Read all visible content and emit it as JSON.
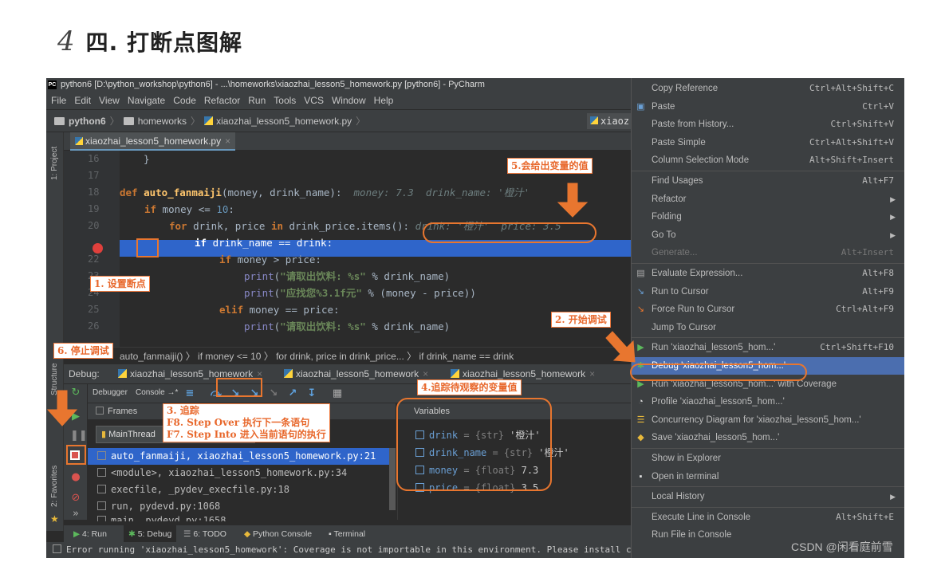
{
  "heading": {
    "number": "4",
    "title": "四. 打断点图解"
  },
  "window_title": "python6 [D:\\python_workshop\\python6] - ...\\homeworks\\xiaozhai_lesson5_homework.py [python6] - PyCharm",
  "menubar": [
    "File",
    "Edit",
    "View",
    "Navigate",
    "Code",
    "Refactor",
    "Run",
    "Tools",
    "VCS",
    "Window",
    "Help"
  ],
  "navbar": {
    "project": "python6",
    "folder": "homeworks",
    "file": "xiaozhai_lesson5_homework.py",
    "right": "xiaoz"
  },
  "sidebar": {
    "project_label": "1: Project",
    "structure_label": "Structure",
    "favorites_label": "2: Favorites"
  },
  "editor": {
    "tab": "xiaozhai_lesson5_homework.py",
    "line_numbers": [
      "16",
      "17",
      "18",
      "19",
      "20",
      "21",
      "22",
      "23",
      "24",
      "25",
      "26"
    ],
    "code": {
      "l16": "}",
      "l18_kw": "def ",
      "l18_fn": "auto_fanmaiji",
      "l18_args": "(money, drink_name):",
      "l18_ann": "  money: 7.3  drink_name: '橙汁'",
      "l19_kw": "if ",
      "l19_a": "money <= ",
      "l19_num": "10",
      "l19_b": ":",
      "l20_kw": "for ",
      "l20_a": "drink, price ",
      "l20_kw2": "in ",
      "l20_b": "drink_price.items():",
      "l20_ann": " drink: '橙汁'  price: 3.5",
      "l21_kw": "if ",
      "l21_a": "drink_name == drink:",
      "l22_kw": "if ",
      "l22_a": "money > price:",
      "l23_blt": "print",
      "l23_a": "(",
      "l23_str": "\"请取出饮料: %s\"",
      "l23_b": " % drink_name)",
      "l24_blt": "print",
      "l24_a": "(",
      "l24_str": "\"应找您%3.1f元\"",
      "l24_b": " % (money - price))",
      "l25_kw": "elif ",
      "l25_a": "money == price:",
      "l26_blt": "print",
      "l26_a": "(",
      "l26_str": "\"请取出饮料: %s\"",
      "l26_b": " % drink_name)"
    },
    "breadcrumbs": "auto_fanmaiji()  〉 if money <= 10  〉 for drink, price in drink_price...  〉 if drink_name == drink"
  },
  "debug": {
    "label": "Debug:",
    "tabs": [
      "xiaozhai_lesson5_homework",
      "xiaozhai_lesson5_homework",
      "xiaozhai_lesson5_homework"
    ],
    "debugger_tab": "Debugger",
    "console_tab": "Console →*",
    "frames_header": "Frames",
    "variables_header": "Variables",
    "thread": "MainThread",
    "frames": [
      "auto_fanmaiji, xiaozhai_lesson5_homework.py:21",
      "<module>, xiaozhai_lesson5_homework.py:34",
      "execfile, _pydev_execfile.py:18",
      "run, pydevd.py:1068",
      "main, pydevd.py:1658"
    ],
    "variables": [
      {
        "name": "drink",
        "type": "= {str} ",
        "value": "'橙汁'"
      },
      {
        "name": "drink_name",
        "type": "= {str} ",
        "value": "'橙汁'"
      },
      {
        "name": "money",
        "type": "= {float} ",
        "value": "7.3"
      },
      {
        "name": "price",
        "type": "= {float} ",
        "value": "3.5"
      }
    ]
  },
  "bottom_tabs": [
    "4: Run",
    "5: Debug",
    "6: TODO",
    "Python Console",
    "Terminal"
  ],
  "status": "Error running 'xiaozhai_lesson5_homework': Coverage is not importable in this environment. Please install coverage.py t",
  "context_menu": [
    {
      "label": "Copy Reference",
      "shortcut": "Ctrl+Alt+Shift+C"
    },
    {
      "label": "Paste",
      "shortcut": "Ctrl+V",
      "icon": "paste-icon"
    },
    {
      "label": "Paste from History...",
      "shortcut": "Ctrl+Shift+V"
    },
    {
      "label": "Paste Simple",
      "shortcut": "Ctrl+Alt+Shift+V"
    },
    {
      "label": "Column Selection Mode",
      "shortcut": "Alt+Shift+Insert"
    },
    {
      "label": "Find Usages",
      "shortcut": "Alt+F7"
    },
    {
      "label": "Refactor",
      "submenu": true
    },
    {
      "label": "Folding",
      "submenu": true
    },
    {
      "label": "Go To",
      "submenu": true
    },
    {
      "label": "Generate...",
      "shortcut": "Alt+Insert",
      "disabled": true
    },
    {
      "label": "Evaluate Expression...",
      "shortcut": "Alt+F8"
    },
    {
      "label": "Run to Cursor",
      "shortcut": "Alt+F9"
    },
    {
      "label": "Force Run to Cursor",
      "shortcut": "Ctrl+Alt+F9"
    },
    {
      "label": "Jump To Cursor"
    },
    {
      "label": "Run 'xiaozhai_lesson5_hom...'",
      "shortcut": "Ctrl+Shift+F10"
    },
    {
      "label": "Debug 'xiaozhai_lesson5_hom...'",
      "selected": true
    },
    {
      "label": "Run 'xiaozhai_lesson5_hom...' with Coverage"
    },
    {
      "label": "Profile 'xiaozhai_lesson5_hom...'"
    },
    {
      "label": "Concurrency Diagram for 'xiaozhai_lesson5_hom...'"
    },
    {
      "label": "Save 'xiaozhai_lesson5_hom...'"
    },
    {
      "label": "Show in Explorer"
    },
    {
      "label": "Open in terminal"
    },
    {
      "label": "Local History",
      "submenu": true
    },
    {
      "label": "Execute Line in Console",
      "shortcut": "Alt+Shift+E"
    },
    {
      "label": "Run File in Console"
    }
  ],
  "annotations": {
    "a1": "1. 设置断点",
    "a2": "2. 开始调试",
    "a3_title": "3. 追踪",
    "a3_l1": "F8. Step Over 执行下一条语句",
    "a3_l2": "F7. Step Into 进入当前语句的执行",
    "a4": "4.追踪待观察的变量值",
    "a5": "5.会给出变量的值",
    "a6": "6. 停止调试"
  },
  "watermark": "CSDN @闲看庭前雪",
  "colors": {
    "accent": "#e8762f",
    "selection": "#2f65ca",
    "menu_selection": "#4b6eaf"
  }
}
